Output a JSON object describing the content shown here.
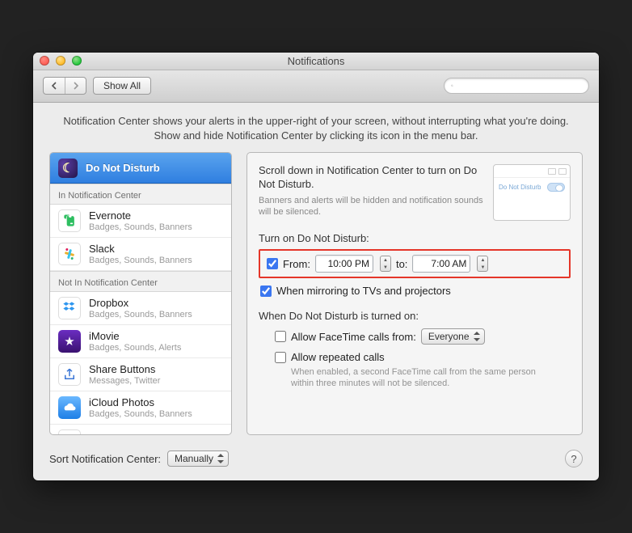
{
  "window": {
    "title": "Notifications"
  },
  "toolbar": {
    "showAll": "Show All",
    "searchPlaceholder": ""
  },
  "intro": "Notification Center shows your alerts in the upper-right of your screen, without interrupting what you're doing. Show and hide Notification Center by clicking its icon in the menu bar.",
  "sidebar": {
    "selected": "Do Not Disturb",
    "section1": "In Notification Center",
    "section2": "Not In Notification Center",
    "apps_in": [
      {
        "name": "Evernote",
        "sub": "Badges, Sounds, Banners"
      },
      {
        "name": "Slack",
        "sub": "Badges, Sounds, Banners"
      }
    ],
    "apps_out": [
      {
        "name": "Dropbox",
        "sub": "Badges, Sounds, Banners"
      },
      {
        "name": "iMovie",
        "sub": "Badges, Sounds, Alerts"
      },
      {
        "name": "Share Buttons",
        "sub": "Messages, Twitter"
      },
      {
        "name": "iCloud Photos",
        "sub": "Badges, Sounds, Banners"
      }
    ]
  },
  "detail": {
    "heading": "Scroll down in Notification Center to turn on Do Not Disturb.",
    "subtext": "Banners and alerts will be hidden and notification sounds will be silenced.",
    "previewLabel": "Do Not Disturb",
    "turnOnLabel": "Turn on Do Not Disturb:",
    "fromLabel": "From:",
    "fromTime": "10:00 PM",
    "toLabel": "to:",
    "toTime": "7:00 AM",
    "mirrorLabel": "When mirroring to TVs and projectors",
    "whenOnLabel": "When Do Not Disturb is turned on:",
    "facetimeLabel": "Allow FaceTime calls from:",
    "facetimeSelect": "Everyone",
    "repeatedLabel": "Allow repeated calls",
    "repeatedNote": "When enabled, a second FaceTime call from the same person within three minutes will not be silenced."
  },
  "footer": {
    "sortLabel": "Sort Notification Center:",
    "sortValue": "Manually"
  }
}
